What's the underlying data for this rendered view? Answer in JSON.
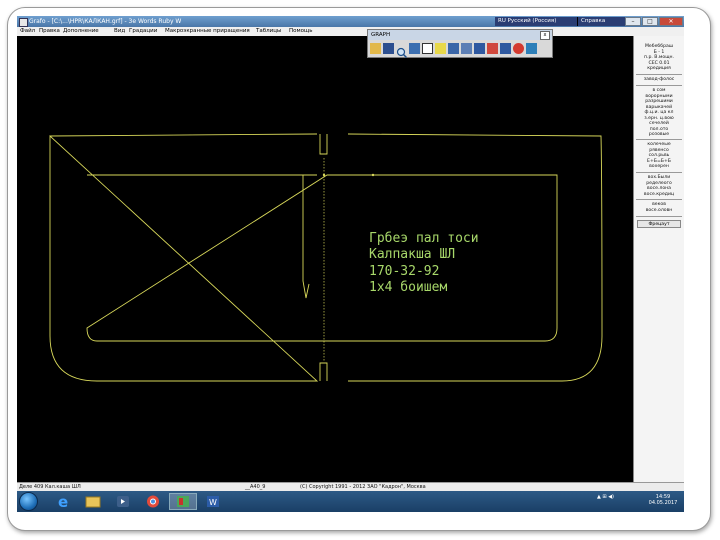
{
  "window": {
    "title": "Grafo - [C:\\...\\HPR\\КАЛКАН.grf] - 3e Words Ruby W",
    "lang_primary": "RU Русский (Россия)",
    "lang_secondary": "Справка",
    "min_label": "–",
    "max_label": "□",
    "close_label": "✕"
  },
  "menu": {
    "items": [
      "Файл",
      "Правка",
      "Дополнение",
      "Вид",
      "Градации",
      "Макроэкранные приращения",
      "Таблицы",
      "Помощь"
    ]
  },
  "toolbar": {
    "title": "GRAPH",
    "close_label": "x",
    "buttons": [
      "open-folder-icon",
      "save-icon",
      "zoom-icon",
      "print-icon",
      "window-icon",
      "ruler-icon",
      "grid-icon",
      "tools-icon",
      "text-icon",
      "anchor-icon",
      "weight-icon",
      "stop-icon",
      "mail-icon"
    ]
  },
  "drawing": {
    "text_lines": [
      "Грбеэ пал тоси",
      "Калпакша ШЛ",
      "170-32-92",
      "1x4 боишем"
    ],
    "stroke_color": "#d8d85a",
    "text_color": "#a8d86a"
  },
  "side_panel": {
    "block1": [
      "Мебеббраш",
      "Б - 1",
      "п.р. В.мощн.",
      "СЕС 0.01",
      "кредиция"
    ],
    "block2": [
      "завод-фолос"
    ],
    "block3": [
      "в сом",
      "ворорными",
      "разрешими",
      "варыкачей",
      "ф.ц.и. ца кл",
      "з.ерн. ц.вою",
      "сечелей",
      "пол.ото",
      "розовые"
    ],
    "block4": [
      "колечеые",
      "рявенсо",
      "сол.рьвь",
      "Е+Б=Б+Б",
      "вохерен"
    ],
    "block5": [
      "вох.Были",
      "ределеого",
      "восе.лона",
      "восе.кредиц"
    ],
    "block6": [
      "веков",
      "восе.оловн"
    ],
    "button_label": "Фрецаут"
  },
  "status": {
    "left": "Деле 409 Кал.каша ШЛ",
    "middle": "__А40_9",
    "right": "(С) Copyright 1991 - 2012 ЗАО \"Кадрон\", Москва"
  },
  "taskbar": {
    "apps": [
      "ie-icon",
      "explorer-icon",
      "media-icon",
      "chrome-icon",
      "grafo-icon",
      "word-icon"
    ],
    "tray_text": "▲ ⊞ ◀)",
    "time": "14:59",
    "date": "04.05.2017"
  }
}
